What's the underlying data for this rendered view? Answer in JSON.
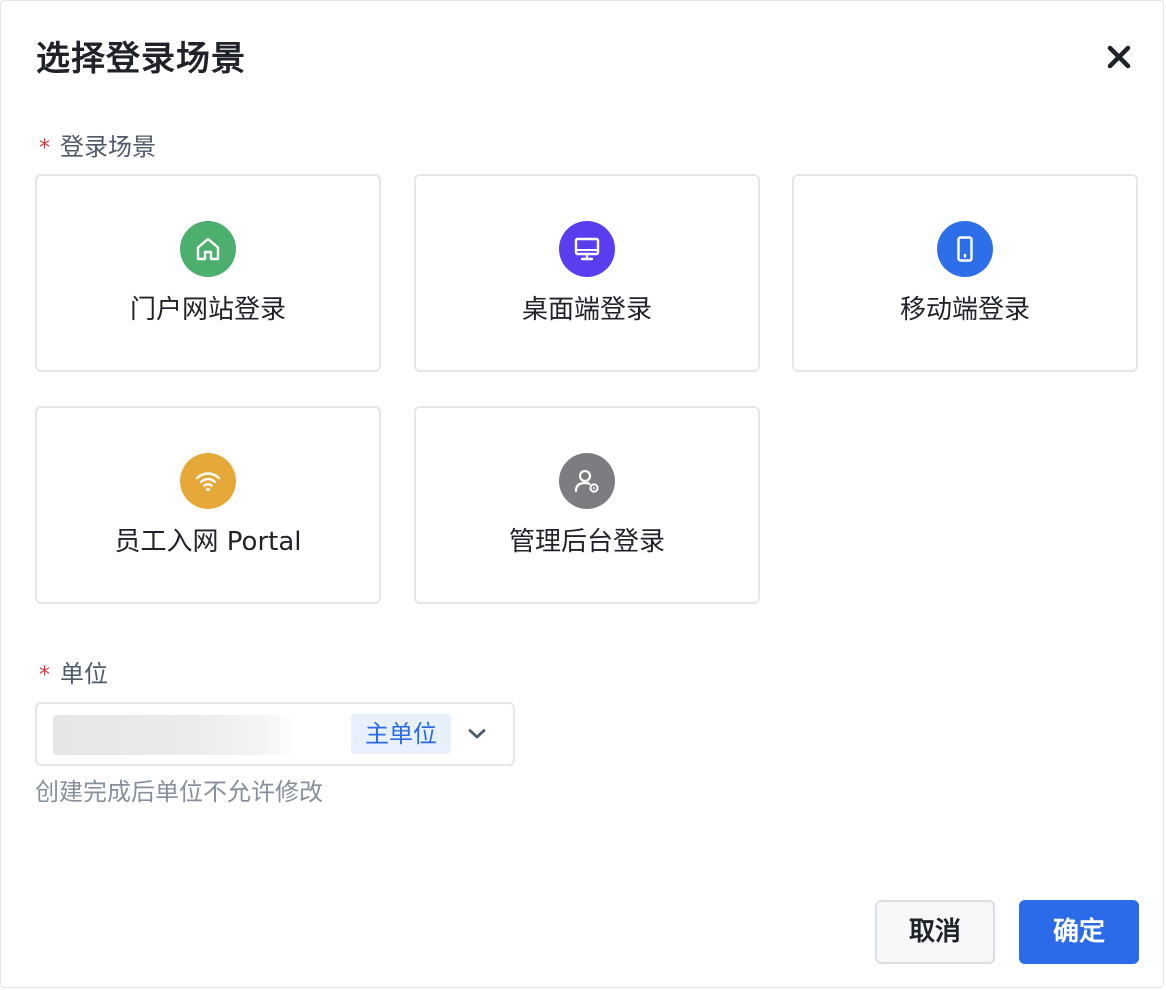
{
  "dialog": {
    "title": "选择登录场景",
    "close_icon": "close-icon"
  },
  "scene_field": {
    "required_mark": "*",
    "label": "登录场景",
    "cards": [
      {
        "label": "门户网站登录",
        "icon": "home-icon",
        "color": "#4caf6e"
      },
      {
        "label": "桌面端登录",
        "icon": "monitor-icon",
        "color": "#5b3df0"
      },
      {
        "label": "移动端登录",
        "icon": "mobile-icon",
        "color": "#2d6fe8"
      },
      {
        "label": "员工入网 Portal",
        "icon": "wifi-icon",
        "color": "#e7a83a"
      },
      {
        "label": "管理后台登录",
        "icon": "user-settings-icon",
        "color": "#7b7d80"
      }
    ]
  },
  "unit_field": {
    "required_mark": "*",
    "label": "单位",
    "tag": "主单位",
    "hint": "创建完成后单位不允许修改"
  },
  "footer": {
    "cancel_label": "取消",
    "ok_label": "确定"
  },
  "colors": {
    "primary": "#2b6ae8",
    "required": "#d9363e",
    "tag_bg": "#e8f0fe",
    "tag_text": "#2a6ae9"
  }
}
